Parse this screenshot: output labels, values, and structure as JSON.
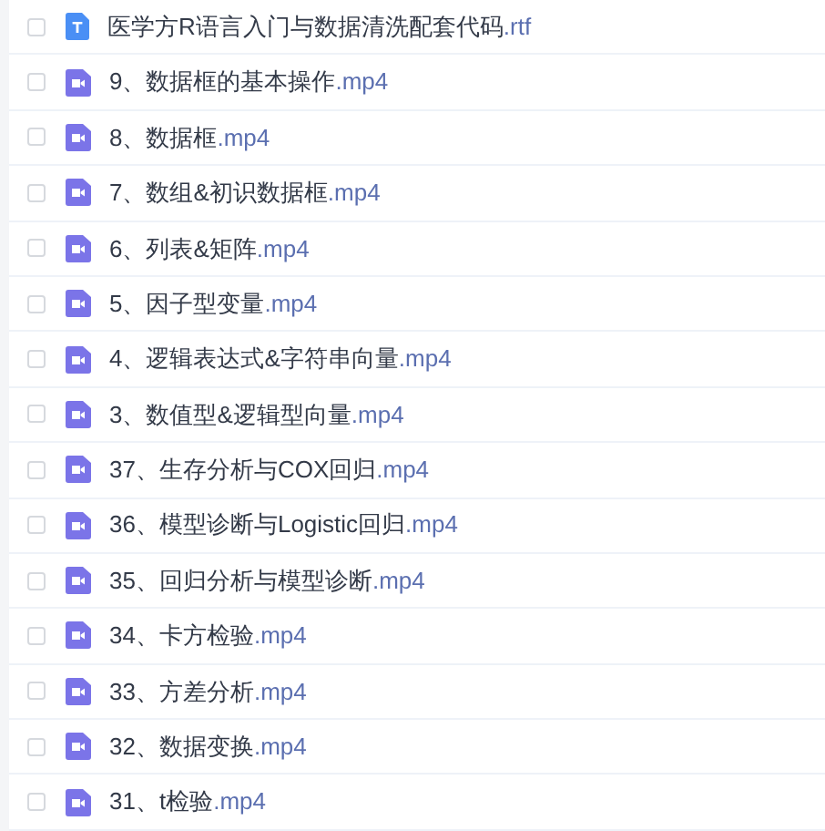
{
  "files": [
    {
      "kind": "doc",
      "name": "医学方R语言入门与数据清洗配套代码",
      "ext": ".rtf",
      "checked": false
    },
    {
      "kind": "video",
      "name": "9、数据框的基本操作",
      "ext": ".mp4",
      "checked": false
    },
    {
      "kind": "video",
      "name": "8、数据框",
      "ext": ".mp4",
      "checked": false
    },
    {
      "kind": "video",
      "name": "7、数组&初识数据框",
      "ext": ".mp4",
      "checked": false
    },
    {
      "kind": "video",
      "name": "6、列表&矩阵",
      "ext": ".mp4",
      "checked": false
    },
    {
      "kind": "video",
      "name": "5、因子型变量",
      "ext": ".mp4",
      "checked": false
    },
    {
      "kind": "video",
      "name": "4、逻辑表达式&字符串向量",
      "ext": ".mp4",
      "checked": false
    },
    {
      "kind": "video",
      "name": "3、数值型&逻辑型向量",
      "ext": ".mp4",
      "checked": false
    },
    {
      "kind": "video",
      "name": "37、生存分析与COX回归",
      "ext": ".mp4",
      "checked": false
    },
    {
      "kind": "video",
      "name": "36、模型诊断与Logistic回归",
      "ext": ".mp4",
      "checked": false
    },
    {
      "kind": "video",
      "name": "35、回归分析与模型诊断",
      "ext": ".mp4",
      "checked": false
    },
    {
      "kind": "video",
      "name": "34、卡方检验",
      "ext": ".mp4",
      "checked": false
    },
    {
      "kind": "video",
      "name": "33、方差分析",
      "ext": ".mp4",
      "checked": false
    },
    {
      "kind": "video",
      "name": "32、数据变换",
      "ext": ".mp4",
      "checked": false
    },
    {
      "kind": "video",
      "name": "31、t检验",
      "ext": ".mp4",
      "checked": false
    }
  ]
}
